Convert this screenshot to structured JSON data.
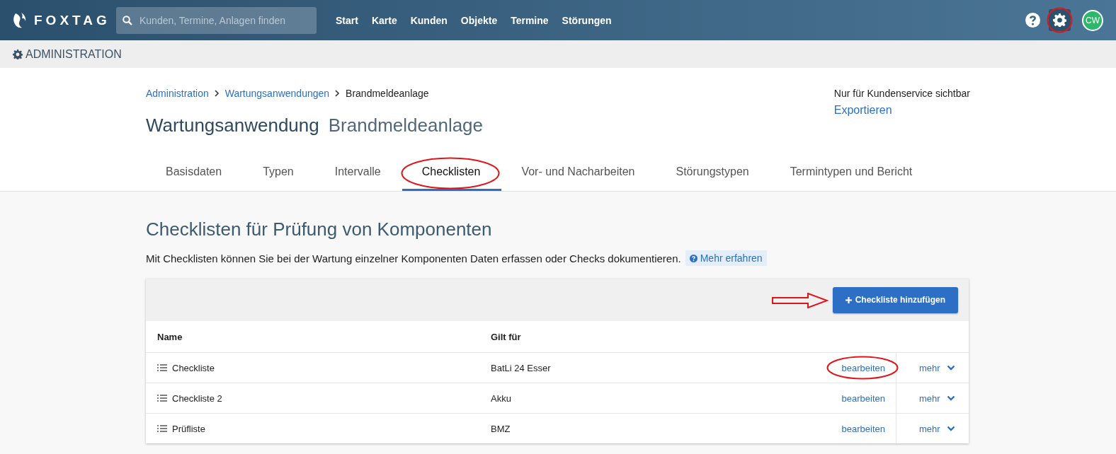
{
  "topbar": {
    "brand": "FOXTAG",
    "search": {
      "placeholder": "Kunden, Termine, Anlagen finden"
    },
    "nav": [
      {
        "label": "Start"
      },
      {
        "label": "Karte"
      },
      {
        "label": "Kunden"
      },
      {
        "label": "Objekte"
      },
      {
        "label": "Termine"
      },
      {
        "label": "Störungen"
      }
    ],
    "settings": {
      "selected": true,
      "circled": true
    },
    "avatar": "CW"
  },
  "admin_bar": {
    "title": "ADMINISTRATION"
  },
  "breadcrumb": [
    {
      "label": "Administration",
      "link": true
    },
    {
      "label": "Wartungsanwendungen",
      "link": true
    },
    {
      "label": "Brandmeldeanlage",
      "link": false
    }
  ],
  "title": {
    "main": "Wartungsanwendung",
    "sub": "Brandmeldeanlage"
  },
  "support": {
    "note": "Nur für Kundenservice sichtbar",
    "link": "Exportieren"
  },
  "tabs": [
    {
      "label": "Basisdaten",
      "selected": false,
      "circled": false
    },
    {
      "label": "Typen",
      "selected": false,
      "circled": false
    },
    {
      "label": "Intervalle",
      "selected": false,
      "circled": false
    },
    {
      "label": "Checklisten",
      "selected": true,
      "circled": true
    },
    {
      "label": "Vor- und Nacharbeiten",
      "selected": false,
      "circled": false
    },
    {
      "label": "Störungstypen",
      "selected": false,
      "circled": false
    },
    {
      "label": "Termintypen und Bericht",
      "selected": false,
      "circled": false
    }
  ],
  "section": {
    "heading": "Checklisten für Prüfung von Komponenten",
    "description": "Mit Checklisten können Sie bei der Wartung einzelner Komponenten Daten erfassen oder Checks dokumentieren.",
    "help_link": "Mehr erfahren"
  },
  "add_button": {
    "label": "Checkliste hinzufügen",
    "arrow_pointed": true
  },
  "table": {
    "columns": [
      "Name",
      "Gilt für"
    ],
    "rows": [
      {
        "name": "Checkliste",
        "applies_to": "BatLi 24 Esser",
        "edit": "bearbeiten",
        "edit_circled": true,
        "more": "mehr"
      },
      {
        "name": "Checkliste 2",
        "applies_to": "Akku",
        "edit": "bearbeiten",
        "edit_circled": false,
        "more": "mehr"
      },
      {
        "name": "Prüfliste",
        "applies_to": "BMZ",
        "edit": "bearbeiten",
        "edit_circled": false,
        "more": "mehr"
      }
    ]
  }
}
